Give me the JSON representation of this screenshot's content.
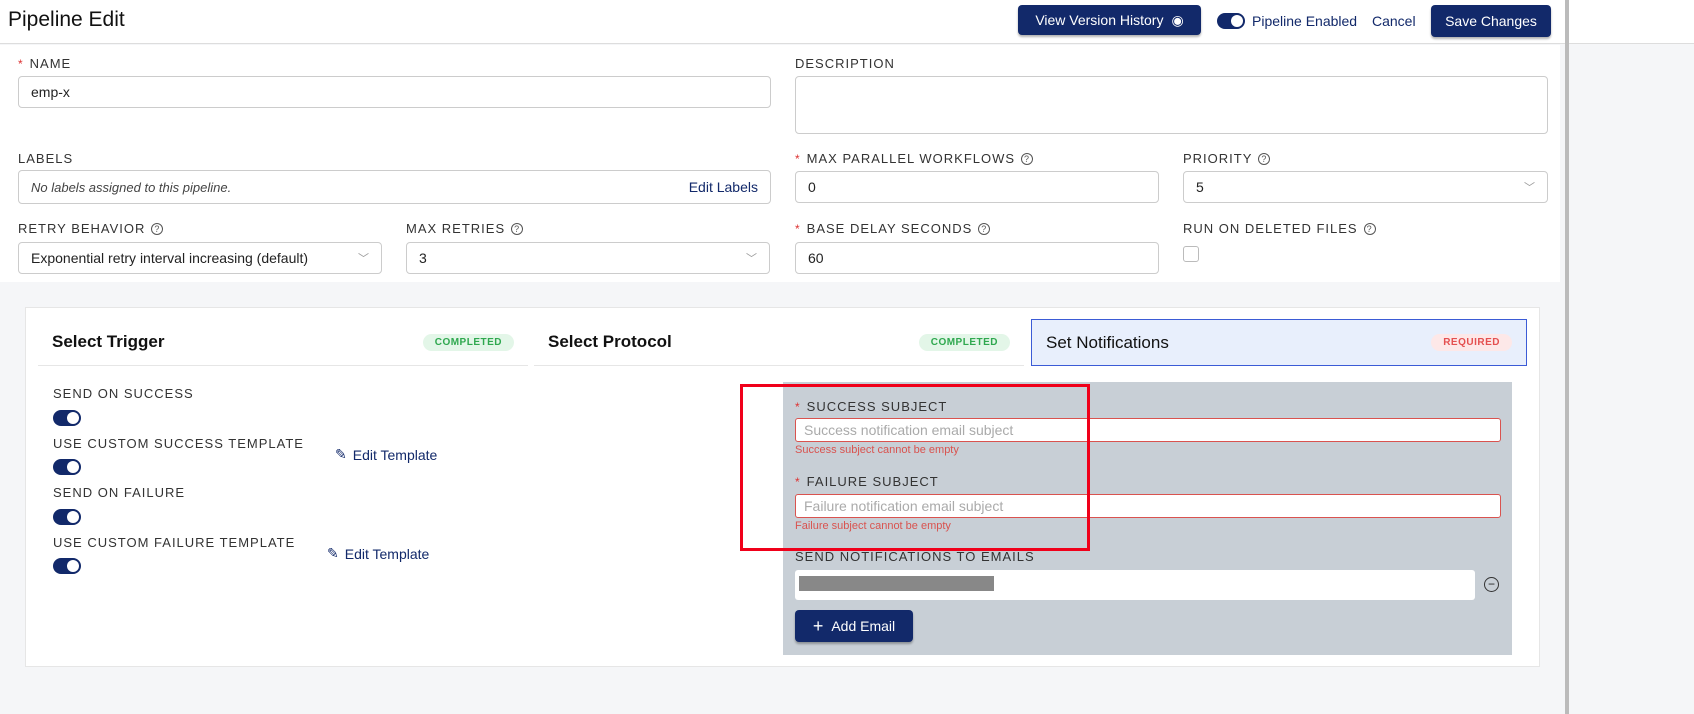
{
  "header": {
    "title": "Pipeline Edit",
    "version_history": "View Version History",
    "pipeline_enabled": "Pipeline Enabled",
    "cancel": "Cancel",
    "save": "Save Changes"
  },
  "form": {
    "name_label": "NAME",
    "name_value": "emp-x",
    "description_label": "DESCRIPTION",
    "description_value": "",
    "labels_label": "LABELS",
    "labels_empty": "No labels assigned to this pipeline.",
    "edit_labels": "Edit Labels",
    "max_parallel_label": "MAX PARALLEL WORKFLOWS",
    "max_parallel_value": "0",
    "priority_label": "PRIORITY",
    "priority_value": "5",
    "retry_label": "RETRY BEHAVIOR",
    "retry_value": "Exponential retry interval increasing (default)",
    "max_retries_label": "MAX RETRIES",
    "max_retries_value": "3",
    "base_delay_label": "BASE DELAY SECONDS",
    "base_delay_value": "60",
    "run_deleted_label": "RUN ON DELETED FILES"
  },
  "tabs": [
    {
      "label": "Select Trigger",
      "badge": "COMPLETED"
    },
    {
      "label": "Select Protocol",
      "badge": "COMPLETED"
    },
    {
      "label": "Set Notifications",
      "badge": "REQUIRED"
    }
  ],
  "notifications": {
    "send_success": "SEND ON SUCCESS",
    "custom_success": "USE CUSTOM SUCCESS TEMPLATE",
    "send_failure": "SEND ON FAILURE",
    "custom_failure": "USE CUSTOM FAILURE TEMPLATE",
    "edit_template": "Edit Template",
    "success_subject_label": "SUCCESS SUBJECT",
    "success_subject_placeholder": "Success notification email subject",
    "success_error": "Success subject cannot be empty",
    "failure_subject_label": "FAILURE SUBJECT",
    "failure_subject_placeholder": "Failure notification email subject",
    "failure_error": "Failure subject cannot be empty",
    "emails_label": "SEND NOTIFICATIONS TO EMAILS",
    "add_email": "Add Email"
  }
}
